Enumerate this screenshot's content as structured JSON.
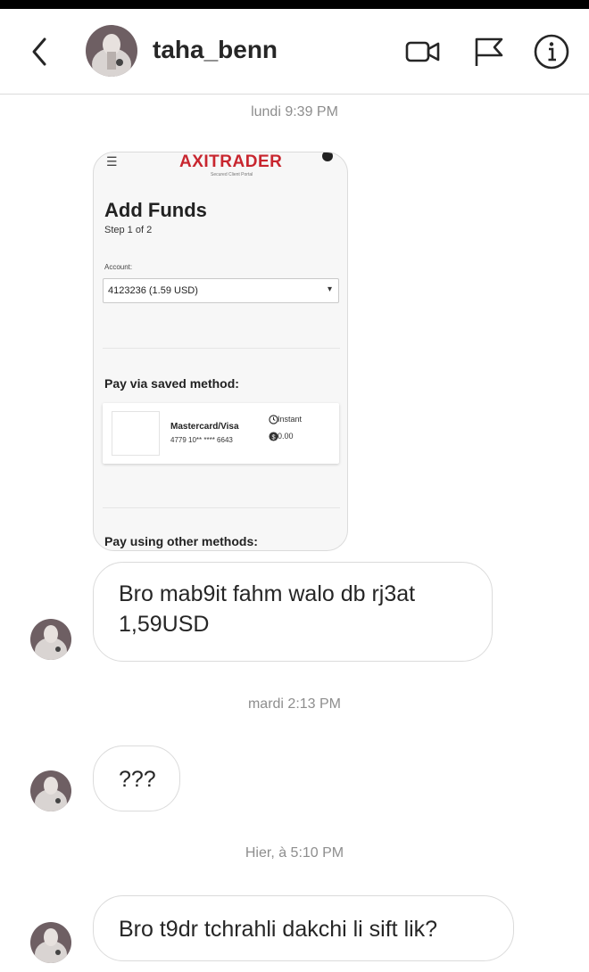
{
  "header": {
    "username": "taha_benn",
    "icons": [
      "back-icon",
      "video-call-icon",
      "flag-icon",
      "info-icon"
    ]
  },
  "messages": {
    "timestamp_1": "lundi 9:39 PM",
    "timestamp_2": "mardi 2:13 PM",
    "timestamp_3": "Hier, à 5:10 PM",
    "bubble_1_line_1": "Bro mab9it fahm walo db rj3at",
    "bubble_1_line_2": "1,59USD",
    "bubble_2": "???",
    "bubble_3": "Bro t9dr tchrahli dakchi li sift lik?"
  },
  "shared_image": {
    "brand": "AXITRADER",
    "brand_sub": "Secured Client Portal",
    "title": "Add Funds",
    "step": "Step 1 of 2",
    "account_label": "Account:",
    "account_value": "4123236 (1.59 USD)",
    "pay_saved": "Pay via saved method:",
    "card_name": "Mastercard/Visa",
    "card_number": "4779 10** **** 6643",
    "speed": "Instant",
    "fee": "0.00",
    "pay_other": "Pay using other methods:"
  },
  "colors": {
    "bubble_border": "#dbdbdb",
    "timestamp": "#8e8e8e",
    "brand_red": "#c8262f"
  }
}
